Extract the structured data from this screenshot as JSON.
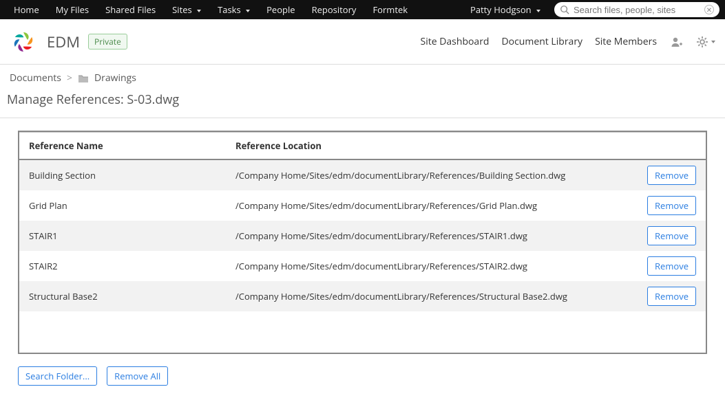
{
  "topnav": {
    "items": [
      {
        "label": "Home",
        "dropdown": false
      },
      {
        "label": "My Files",
        "dropdown": false
      },
      {
        "label": "Shared Files",
        "dropdown": false
      },
      {
        "label": "Sites",
        "dropdown": true
      },
      {
        "label": "Tasks",
        "dropdown": true
      },
      {
        "label": "People",
        "dropdown": false
      },
      {
        "label": "Repository",
        "dropdown": false
      },
      {
        "label": "Formtek",
        "dropdown": false
      }
    ],
    "user": "Patty Hodgson",
    "search_placeholder": "Search files, people, sites"
  },
  "siteheader": {
    "name": "EDM",
    "badge": "Private",
    "links": [
      "Site Dashboard",
      "Document Library",
      "Site Members"
    ]
  },
  "breadcrumb": {
    "root": "Documents",
    "folder": "Drawings"
  },
  "page_title": "Manage References: S-03.dwg",
  "table": {
    "columns": [
      "Reference Name",
      "Reference Location"
    ],
    "rows": [
      {
        "name": "Building Section",
        "location": "/Company Home/Sites/edm/documentLibrary/References/Building Section.dwg"
      },
      {
        "name": "Grid Plan",
        "location": "/Company Home/Sites/edm/documentLibrary/References/Grid Plan.dwg"
      },
      {
        "name": "STAIR1",
        "location": "/Company Home/Sites/edm/documentLibrary/References/STAIR1.dwg"
      },
      {
        "name": "STAIR2",
        "location": "/Company Home/Sites/edm/documentLibrary/References/STAIR2.dwg"
      },
      {
        "name": "Structural Base2",
        "location": "/Company Home/Sites/edm/documentLibrary/References/Structural Base2.dwg"
      }
    ],
    "row_action": "Remove"
  },
  "actions": {
    "search_folder": "Search Folder...",
    "remove_all": "Remove All"
  }
}
